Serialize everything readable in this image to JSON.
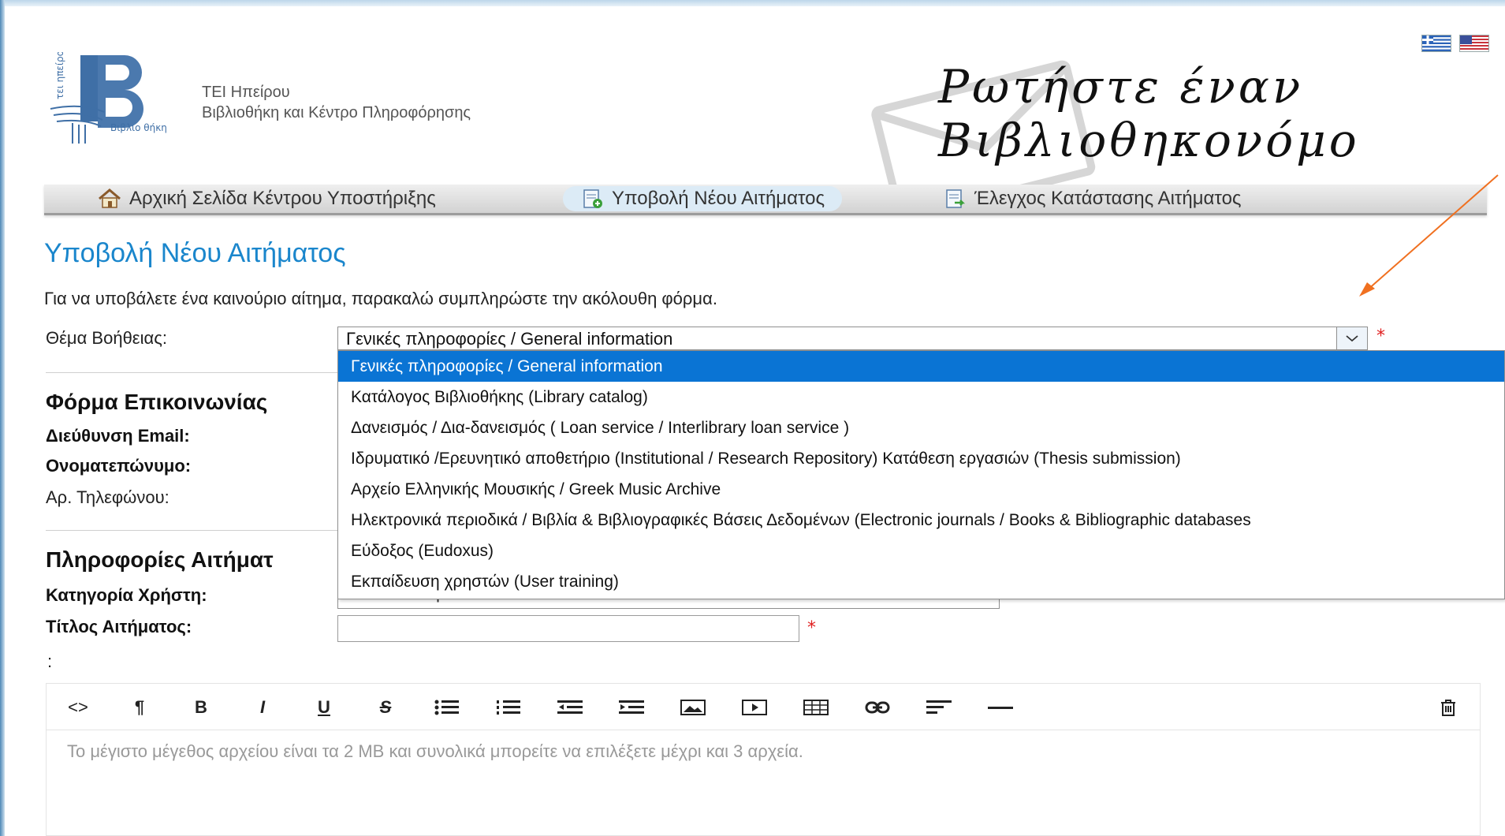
{
  "header": {
    "logo_text": [
      "τει ηπείρου",
      "Βιβλιο θήκη"
    ],
    "institution_line1": "ΤΕΙ Ηπείρου",
    "institution_line2": "Βιβλιοθήκη και Κέντρο Πληροφόρησης",
    "ask_line1": "Ρωτήστε έναν",
    "ask_line2": "Βιβλιοθηκονόμο",
    "languages": [
      "greek-flag-icon",
      "usa-flag-icon"
    ]
  },
  "nav": {
    "items": [
      {
        "label": "Αρχική Σελίδα Κέντρου Υποστήριξης",
        "icon": "home-icon"
      },
      {
        "label": "Υποβολή Νέου Αιτήματος",
        "icon": "new-ticket-icon",
        "active": true
      },
      {
        "label": "Έλεγχος Κατάστασης Αιτήματος",
        "icon": "ticket-status-icon"
      }
    ]
  },
  "page": {
    "title": "Υποβολή Νέου Αιτήματος",
    "intro": "Για να υποβάλετε ένα καινούριο αίτημα, παρακαλώ συμπληρώστε την ακόλουθη φόρμα."
  },
  "form": {
    "help_topic_label": "Θέμα Βοήθειας:",
    "help_topic_value": "Γενικές πληροφορίες / General information",
    "required_mark": "*",
    "contact_section": "Φόρμα Επικοινωνίας",
    "email_label": "Διεύθυνση Email:",
    "name_label": "Ονοματεπώνυμο:",
    "phone_label": "Αρ. Τηλεφώνου:",
    "ticket_section": "Πληροφορίες Αιτήματ",
    "user_category_label": "Κατηγορία Χρήστη:",
    "user_category_value": "Διδακτικό Προσωπικό / Academic Staff",
    "ticket_title_label": "Τίτλος Αιτήματος:",
    "colon_label": ":"
  },
  "dropdown": {
    "options": [
      "Γενικές πληροφορίες / General information",
      "Κατάλογος Βιβλιοθήκης (Library catalog)",
      "Δανεισμός / Δια-δανεισμός ( Loan service / Interlibrary loan service )",
      "Ιδρυματικό /Ερευνητικό αποθετήριο (Institutional / Research Repository) Κατάθεση εργασιών (Thesis submission)",
      "Αρχείο Ελληνικής Μουσικής / Greek Music Archive",
      "Ηλεκτρονικά περιοδικά / Βιβλία & Βιβλιογραφικές Βάσεις Δεδομένων (Electronic journals / Books & Bibliographic databases",
      "Εύδοξος (Eudoxus)",
      "Εκπαίδευση χρηστών (User training)"
    ],
    "selected_index": 0
  },
  "editor": {
    "toolbar": [
      {
        "label": "<>",
        "name": "html-source-button"
      },
      {
        "label": "¶",
        "name": "paragraph-button"
      },
      {
        "label": "B",
        "name": "bold-button"
      },
      {
        "label": "I",
        "name": "italic-button"
      },
      {
        "label": "U",
        "name": "underline-button"
      },
      {
        "label": "S",
        "name": "strikethrough-button"
      }
    ],
    "placeholder": "Το μέγιστο μέγεθος αρχείου είναι τα 2 MB και συνολικά μπορείτε να επιλέξετε μέχρι και 3 αρχεία."
  },
  "colors": {
    "title_blue": "#1a86cc",
    "selected_option": "#0a74d4",
    "required": "#e02020",
    "annotation_arrow": "#f07020"
  }
}
